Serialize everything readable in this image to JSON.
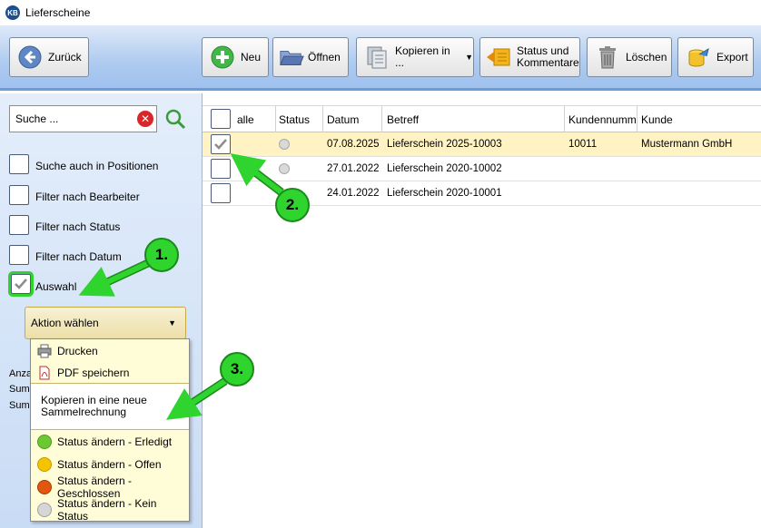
{
  "window": {
    "logo": "KB",
    "title": "Lieferscheine"
  },
  "toolbar": {
    "back": "Zurück",
    "new": "Neu",
    "open": "Öffnen",
    "copy": "Kopieren in ...",
    "status_line1": "Status und",
    "status_line2": "Kommentare",
    "delete": "Löschen",
    "export": "Export"
  },
  "search": {
    "value": "Suche ..."
  },
  "filters": [
    {
      "label": "Suche auch in Positionen",
      "checked": false
    },
    {
      "label": "Filter nach Bearbeiter",
      "checked": false
    },
    {
      "label": "Filter nach Status",
      "checked": false
    },
    {
      "label": "Filter nach Datum",
      "checked": false
    },
    {
      "label": "Auswahl",
      "checked": true
    }
  ],
  "action_select": {
    "value": "Aktion wählen"
  },
  "action_menu": [
    {
      "label": "Drucken",
      "icon": "printer-icon"
    },
    {
      "label": "PDF speichern",
      "icon": "pdf-icon"
    },
    {
      "label_line1": "Kopieren in eine neue",
      "label_line2": "Sammelrechnung"
    },
    {
      "label": "Status ändern - Erledigt",
      "color": "#6cc832"
    },
    {
      "label": "Status ändern - Offen",
      "color": "#f5c400"
    },
    {
      "label": "Status ändern - Geschlossen",
      "color": "#e2560e"
    },
    {
      "label": "Status ändern - Kein Status",
      "color": "#d6d6d6"
    }
  ],
  "summary_labels": [
    "Anza",
    "Summ",
    "Summ"
  ],
  "grid": {
    "columns": [
      "alle",
      "Status",
      "Datum",
      "Betreff",
      "Kundennumm",
      "Kunde"
    ],
    "rows": [
      {
        "checked": true,
        "date": "07.08.2025",
        "subject": "Lieferschein 2025-10003",
        "customer_no": "10011",
        "customer": "Mustermann GmbH"
      },
      {
        "checked": false,
        "date": "27.01.2022",
        "subject": "Lieferschein 2020-10002",
        "customer_no": "",
        "customer": ""
      },
      {
        "checked": false,
        "date": "24.01.2022",
        "subject": "Lieferschein 2020-10001",
        "customer_no": "",
        "customer": ""
      }
    ]
  },
  "annotations": {
    "badge1": "1.",
    "badge2": "2.",
    "badge3": "3.",
    "color": "#2fd42f"
  }
}
